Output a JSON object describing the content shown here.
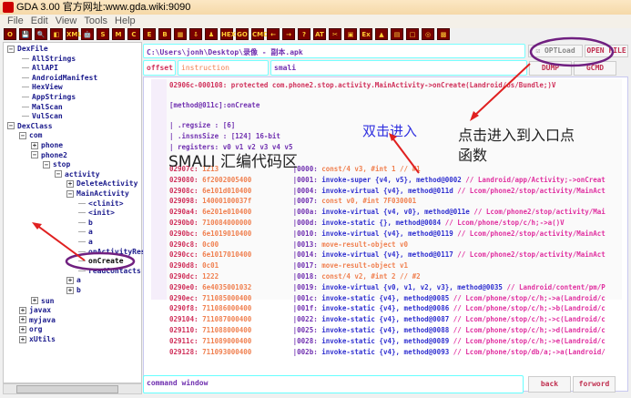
{
  "title": "GDA 3.00 官方网址:www.gda.wiki:9090",
  "menu": [
    "File",
    "Edit",
    "View",
    "Tools",
    "Help"
  ],
  "toolbar": [
    "O",
    "💾",
    "🔍",
    "◧",
    "XML",
    "🤖",
    "S",
    "M",
    "C",
    "E",
    "B",
    "▦",
    "⇩",
    "♟",
    "HEX",
    "GO",
    "CMD",
    "←",
    "→",
    "?",
    "AT",
    "✂",
    "▣",
    "Ex",
    "▲",
    "▤",
    "□",
    "◎",
    "▩"
  ],
  "tree": {
    "dexfile": "DexFile",
    "dexfile_items": [
      "AllStrings",
      "AllAPI",
      "AndroidManifest",
      "HexView",
      "AppStrings",
      "MalScan",
      "VulScan"
    ],
    "dexclass": "DexClass",
    "com": "com",
    "phone": "phone",
    "phone2": "phone2",
    "stop": "stop",
    "activity": "activity",
    "delete": "DeleteActivity",
    "main": "MainActivity",
    "methods": [
      "<clinit>",
      "<init>",
      "b",
      "a",
      "a",
      "onActivityRes",
      "onCreate",
      "readContacts"
    ],
    "a": "a",
    "b": "b",
    "sun": "sun",
    "others": [
      "javax",
      "myjava",
      "org",
      "xUtils"
    ]
  },
  "path": "C:\\Users\\jonh\\Desktop\\录像 - 副本.apk",
  "optload": "OPTLoad",
  "open_file": "OPEN FILE",
  "headers": {
    "offset": "offset",
    "instruction": "instruction",
    "smali": "smali"
  },
  "dump": "DUMP",
  "gcmd": "GCMD",
  "code": {
    "sig": "02906c-000108: protected com.phone2.stop.activity.MainActivity->onCreate(Landroid/os/Bundle;)V",
    "method": "[method@011c]:onCreate",
    "regsize": "|  .regsize      : [6]",
    "insns": "|  .insnsSize    : [124] 16-bit",
    "registers": "|  registers:   v0  v1  v2  v3  v4  v5",
    "lines": [
      [
        "02907c:",
        "1213",
        "|0000:",
        "const/4 v3, #int 1 // #1",
        ""
      ],
      [
        "029080:",
        "6f2002005400",
        "|0001:",
        "invoke-super {v4, v5}, method@0002",
        "// Landroid/app/Activity;->onCreat"
      ],
      [
        "02908c:",
        "6e101d010400",
        "|0004:",
        "invoke-virtual {v4}, method@011d",
        "// Lcom/phone2/stop/activity/MainAct"
      ],
      [
        "029098:",
        "14000100037f",
        "|0007:",
        "const v0, #int 7F030001",
        ""
      ],
      [
        "0290a4:",
        "6e201e010400",
        "|000a:",
        "invoke-virtual {v4, v0}, method@011e",
        "// Lcom/phone2/stop/activity/Mai"
      ],
      [
        "0290b0:",
        "710084000000",
        "|000d:",
        "invoke-static {}, method@0084",
        "// Lcom/phone/stop/c/h;->a()V"
      ],
      [
        "0290bc:",
        "6e1019010400",
        "|0010:",
        "invoke-virtual {v4}, method@0119",
        "// Lcom/phone2/stop/activity/MainAct"
      ],
      [
        "0290c8:",
        "0c00",
        "|0013:",
        "move-result-object v0",
        ""
      ],
      [
        "0290cc:",
        "6e1017010400",
        "|0014:",
        "invoke-virtual {v4}, method@0117",
        "// Lcom/phone2/stop/activity/MainAct"
      ],
      [
        "0290d8:",
        "0c01",
        "|0017:",
        "move-result-object v1",
        ""
      ],
      [
        "0290dc:",
        "1222",
        "|0018:",
        "const/4 v2, #int 2 // #2",
        ""
      ],
      [
        "0290e0:",
        "6e4035001032",
        "|0019:",
        "invoke-virtual {v0, v1, v2, v3}, method@0035",
        "// Landroid/content/pm/P"
      ],
      [
        "0290ec:",
        "711085000400",
        "|001c:",
        "invoke-static {v4}, method@0085",
        "// Lcom/phone/stop/c/h;->a(Landroid/c"
      ],
      [
        "0290f8:",
        "711086000400",
        "|001f:",
        "invoke-static {v4}, method@0086",
        "// Lcom/phone/stop/c/h;->b(Landroid/c"
      ],
      [
        "029104:",
        "711087000400",
        "|0022:",
        "invoke-static {v4}, method@0087",
        "// Lcom/phone/stop/c/h;->c(Landroid/c"
      ],
      [
        "029110:",
        "711088000400",
        "|0025:",
        "invoke-static {v4}, method@0088",
        "// Lcom/phone/stop/c/h;->d(Landroid/c"
      ],
      [
        "02911c:",
        "711089000400",
        "|0028:",
        "invoke-static {v4}, method@0089",
        "// Lcom/phone/stop/c/h;->e(Landroid/c"
      ],
      [
        "029128:",
        "711093000400",
        "|002b:",
        "invoke-static {v4}, method@0093",
        "// Lcom/phone/stop/db/a;->a(Landroid/"
      ]
    ]
  },
  "command": "command window",
  "back": "back",
  "forward": "forword",
  "annotations": {
    "smali": "SMALI 汇编代码区",
    "dblclick": "双击进入",
    "entry": "点击进入到入口点\n函数"
  }
}
